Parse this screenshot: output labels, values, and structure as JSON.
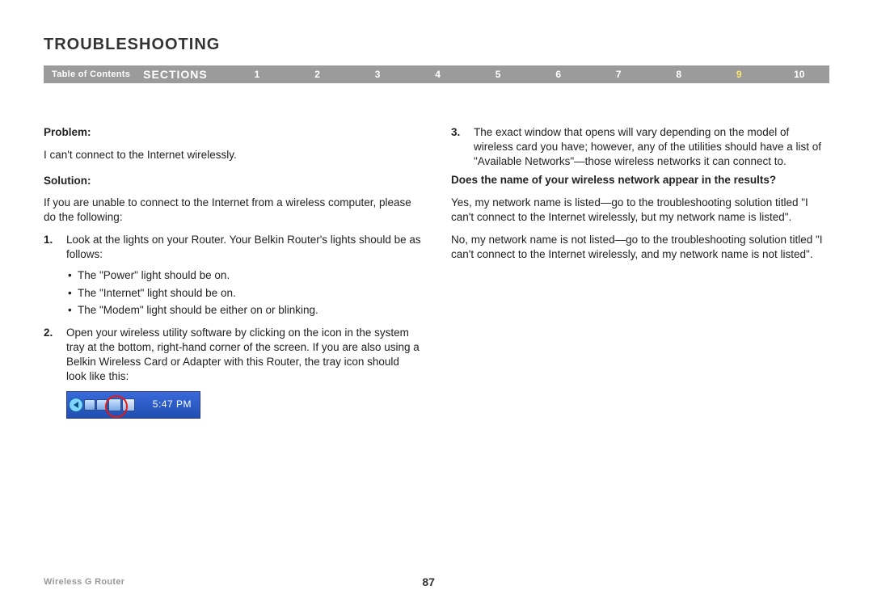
{
  "title": "TROUBLESHOOTING",
  "nav": {
    "toc": "Table of Contents",
    "sections_label": "SECTIONS",
    "nums": [
      "1",
      "2",
      "3",
      "4",
      "5",
      "6",
      "7",
      "8",
      "9",
      "10"
    ],
    "active_index": 8
  },
  "left": {
    "problem_label": "Problem:",
    "problem_text": "I can't connect to the Internet wirelessly.",
    "solution_label": "Solution:",
    "solution_intro": "If you are unable to connect to the Internet from a wireless computer, please do the following:",
    "step1_num": "1.",
    "step1_text": "Look at the lights on your Router. Your Belkin Router's lights should be as follows:",
    "bullets": [
      "The \"Power\" light should be on.",
      "The \"Internet\" light should be on.",
      "The \"Modem\" light should be either on or blinking."
    ],
    "step2_num": "2.",
    "step2_text": "Open your wireless utility software by clicking on the icon in the system tray at the bottom, right-hand corner of the screen. If you are also using a Belkin Wireless Card or Adapter with this Router, the tray icon should look like this:",
    "tray_time": "5:47 PM"
  },
  "right": {
    "step3_num": "3.",
    "step3_text": "The exact window that opens will vary depending on the model of wireless card you have; however, any of the utilities should have a list of \"Available Networks\"—those wireless networks it can connect to.",
    "question": "Does the name of your wireless network appear in the results?",
    "yes_text": "Yes, my network name is listed—go to the troubleshooting solution titled \"I can't connect to the Internet wirelessly, but my network name is listed\".",
    "no_text": "No, my network name is not listed—go to the troubleshooting solution titled \"I can't connect to the Internet wirelessly, and my network name is not listed\"."
  },
  "footer": {
    "product": "Wireless G Router",
    "page": "87"
  }
}
